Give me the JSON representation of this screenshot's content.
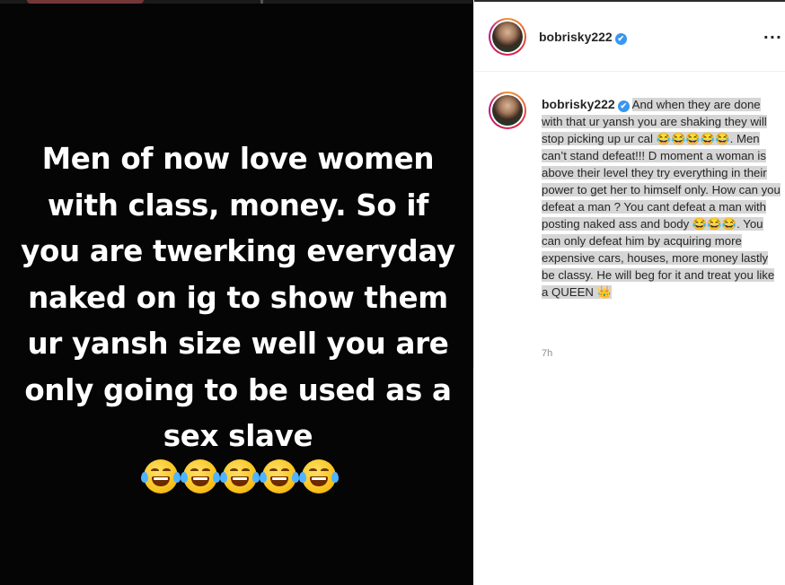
{
  "post": {
    "image_text": "Men of now love women with class, money. So if you are twerking everyday naked on ig to show them ur yansh size well you are only going to be used as a sex slave",
    "image_emojis": [
      "😂",
      "😂",
      "😂",
      "😂",
      "😂"
    ]
  },
  "header": {
    "username": "bobrisky222",
    "verified_icon": "✔",
    "more_label": "···"
  },
  "caption": {
    "username": "bobrisky222",
    "verified_icon": "✔",
    "text": "And when they are done with that ur yansh you are shaking they will stop picking up ur cal 😂😂😂😂😂. Men can’t stand defeat!!! D moment a woman is above their level they try everything in their power to get her to himself only. How can you defeat a man ? You cant defeat a man with posting naked ass and body 😂😂😂. You can only defeat him by acquiring more expensive cars, houses, more money lastly be classy. He will beg for it and treat you like a QUEEN 👑",
    "timestamp": "7h"
  }
}
